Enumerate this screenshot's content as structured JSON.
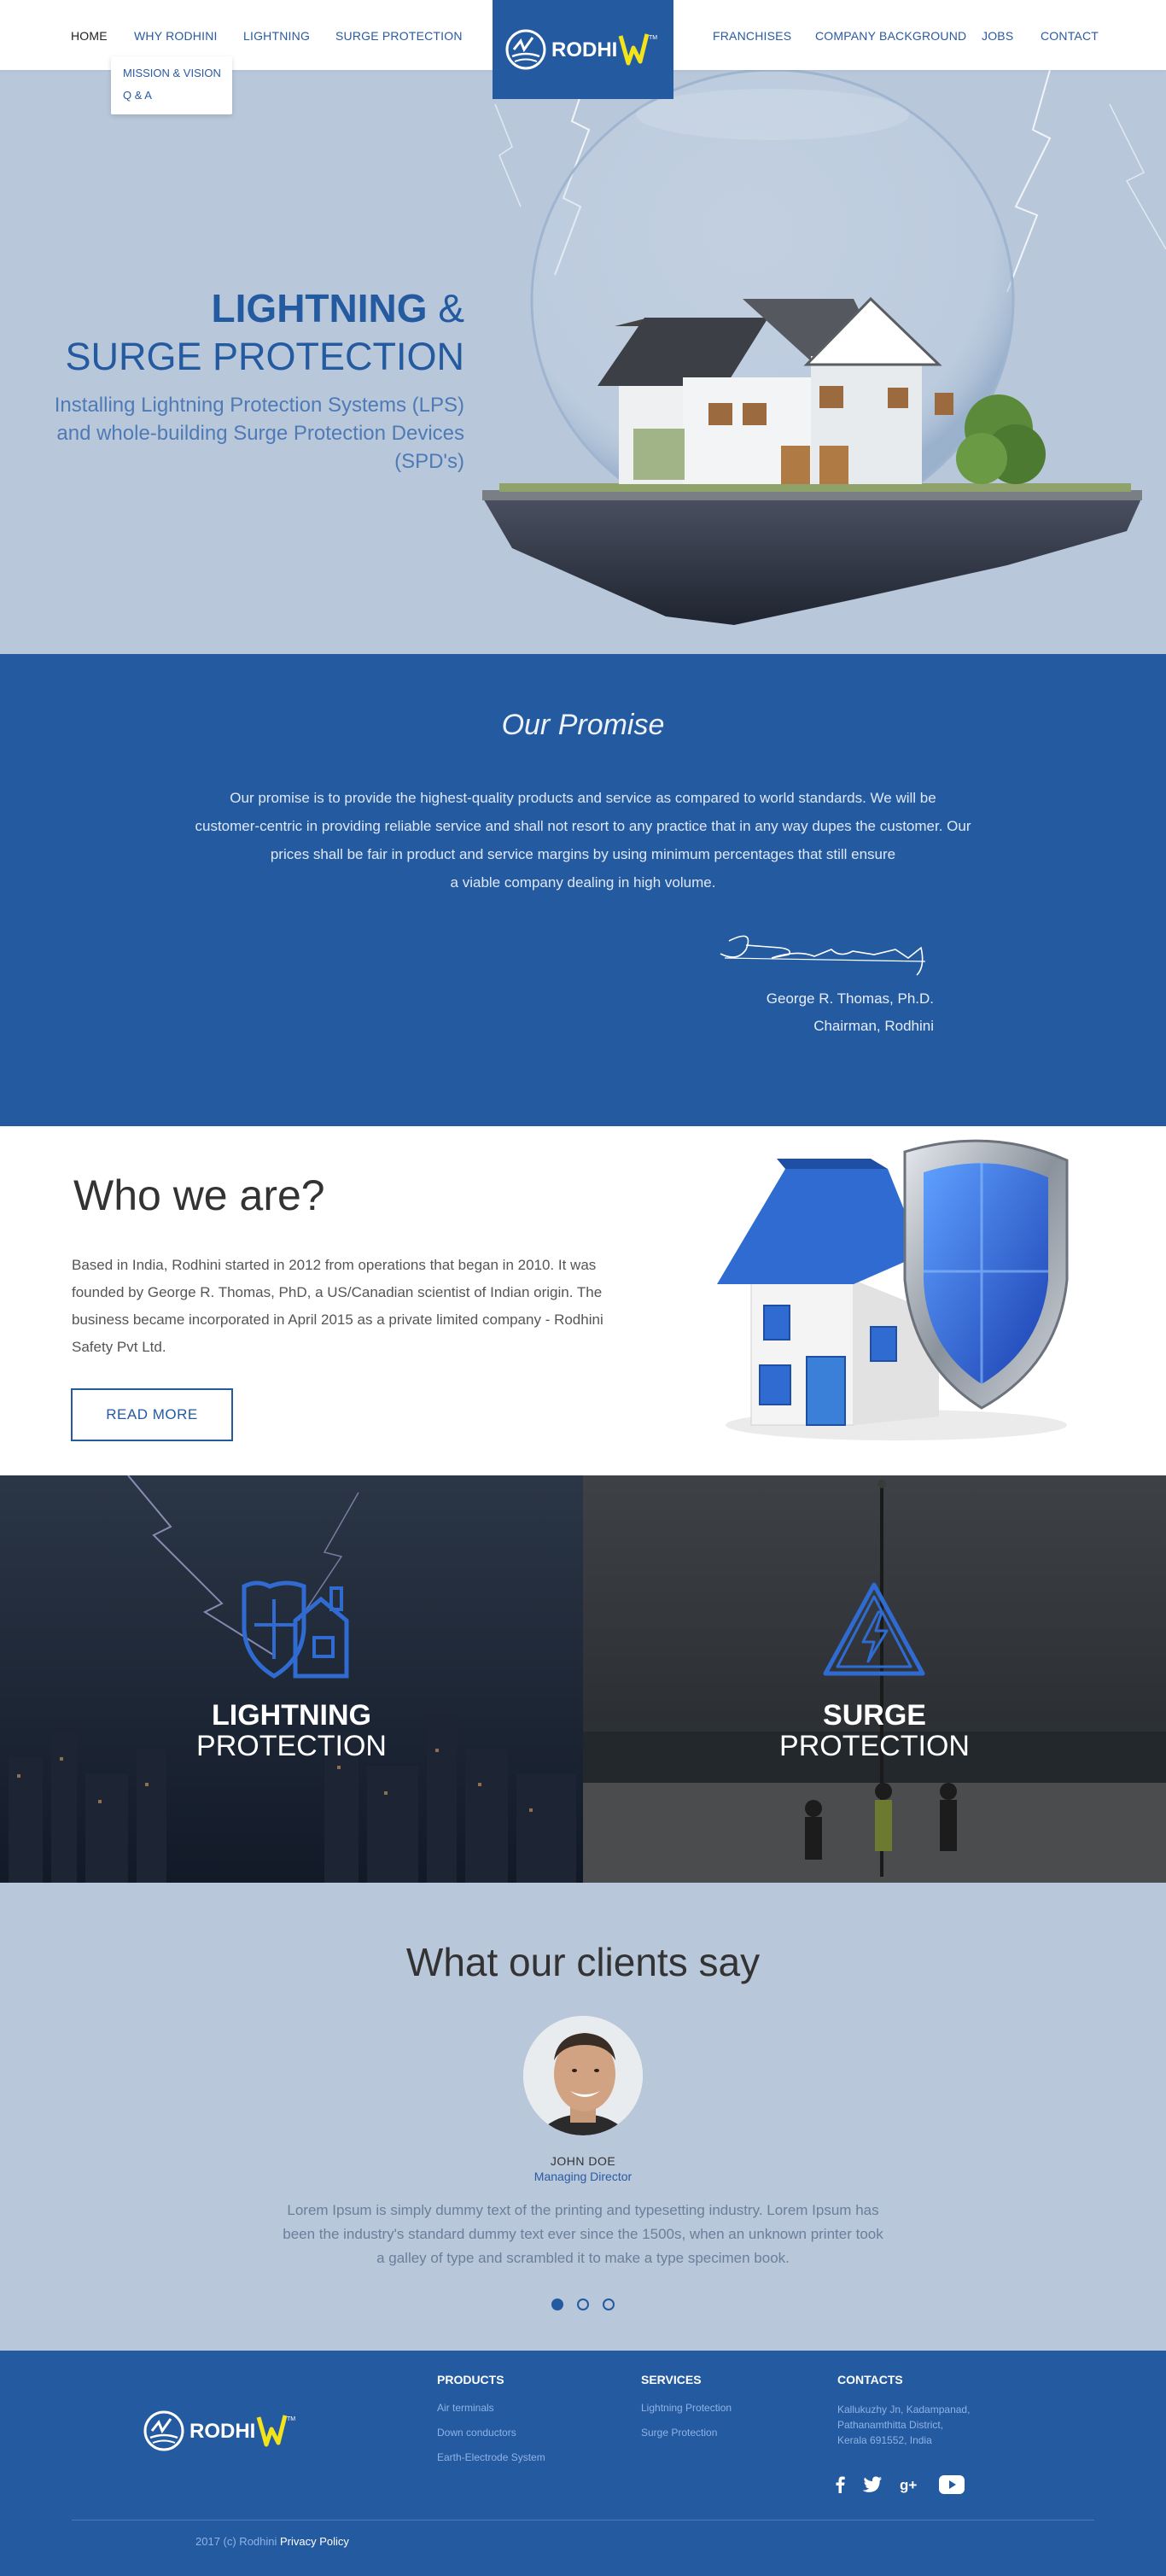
{
  "nav": {
    "left": [
      "HOME",
      "WHY RODHINI",
      "LIGHTNING",
      "SURGE PROTECTION"
    ],
    "right": [
      "FRANCHISES",
      "COMPANY BACKGROUND",
      "JOBS",
      "CONTACT"
    ],
    "dropdown": [
      "MISSION & VISION",
      "Q & A"
    ],
    "logo_text": "RODHINI",
    "accent": "#245aa0"
  },
  "hero": {
    "title_bold": "LIGHTNING",
    "title_amp": "&",
    "title_line2": "SURGE PROTECTION",
    "subtitle": "Installing Lightning Protection Systems (LPS) and whole-building Surge Protection Devices (SPD's)"
  },
  "promise": {
    "heading": "Our Promise",
    "text_1": "Our promise is to provide the highest-quality products and service as compared to world standards. We will be",
    "text_2": "customer-centric in providing reliable service and shall not resort to any practice that in any way dupes the customer. Our",
    "text_3": "prices shall be fair in product and service margins by using minimum percentages that still ensure",
    "text_4": "a viable company dealing in high volume.",
    "signer_name": "George R. Thomas, Ph.D.",
    "signer_title": "Chairman, Rodhini"
  },
  "who": {
    "heading": "Who we are?",
    "text": "Based in India, Rodhini started in 2012 from operations that began in 2010. It was founded by George R. Thomas, PhD, a US/Canadian scientist of Indian origin. The business became incorporated in April 2015 as a private limited company - Rodhini Safety Pvt Ltd.",
    "button": "READ MORE"
  },
  "services": [
    {
      "line1": "LIGHTNING",
      "line2": "PROTECTION",
      "icon": "house-shield-icon"
    },
    {
      "line1": "SURGE",
      "line2": "PROTECTION",
      "icon": "high-voltage-triangle-icon"
    }
  ],
  "clients": {
    "heading": "What our clients say",
    "name": "JOHN DOE",
    "role": "Managing Director",
    "quote": "Lorem Ipsum is simply dummy text of the printing and typesetting industry. Lorem Ipsum has been the industry's standard dummy text ever since the 1500s, when an unknown printer took a galley of type and scrambled it to make a type specimen book."
  },
  "footer": {
    "logo_text": "RODHINI",
    "products": {
      "title": "PRODUCTS",
      "items": [
        "Air terminals",
        "Down conductors",
        "Earth-Electrode System"
      ]
    },
    "services": {
      "title": "SERVICES",
      "items": [
        "Lightning Protection",
        "Surge Protection"
      ]
    },
    "contacts": {
      "title": "CONTACTS",
      "address": [
        "Kallukuzhy Jn, Kadampanad,",
        "Pathanamthitta District,",
        "Kerala 691552, India"
      ]
    },
    "social": [
      "facebook-icon",
      "twitter-icon",
      "google-plus-icon",
      "youtube-icon"
    ],
    "copyright": "2017 (c) Rodhini",
    "privacy": "Privacy Policy"
  }
}
